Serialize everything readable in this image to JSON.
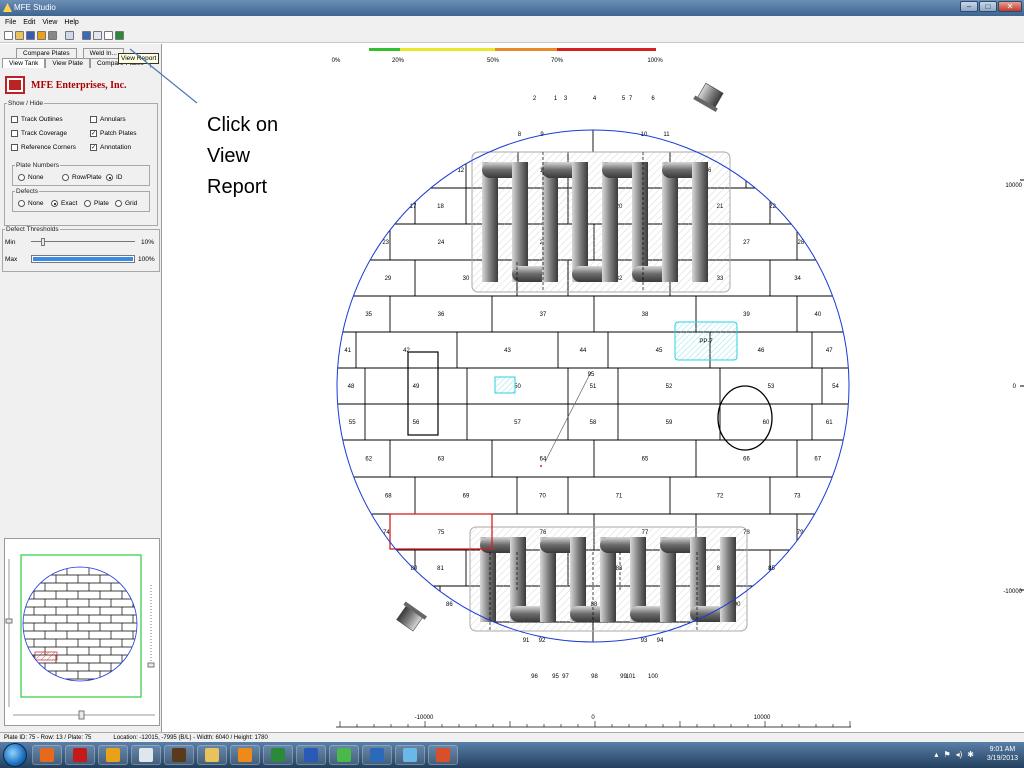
{
  "window": {
    "title": "MFE Studio",
    "controls": [
      "–",
      "□",
      "✕"
    ]
  },
  "menu": [
    "File",
    "Edit",
    "View",
    "Help"
  ],
  "toolbar_icons": [
    "new-icon",
    "open-icon",
    "save-icon",
    "export-icon",
    "print-icon",
    "copy-icon",
    "view-tank-icon",
    "view-plate-icon",
    "report-icon",
    "excel-icon"
  ],
  "tabs": {
    "row1": [
      "Compare Plates",
      "Weld In..."
    ],
    "row2": [
      "View Tank",
      "View Plate",
      "Compare Plates"
    ],
    "tooltip": "View Report"
  },
  "brand": {
    "name": "MFE Enterprises, Inc."
  },
  "show_hide": {
    "legend": "Show / Hide",
    "items": [
      {
        "label": "Track Outlines",
        "checked": false
      },
      {
        "label": "Annulars",
        "checked": false
      },
      {
        "label": "Track Coverage",
        "checked": false
      },
      {
        "label": "Patch Plates",
        "checked": true
      },
      {
        "label": "Reference Corners",
        "checked": false
      },
      {
        "label": "Annotation",
        "checked": true
      }
    ]
  },
  "plate_numbers": {
    "legend": "Plate Numbers",
    "options": [
      "None",
      "Row/Plate",
      "ID"
    ],
    "selected": "ID"
  },
  "defects": {
    "legend": "Defects",
    "options": [
      "None",
      "Exact",
      "Plate",
      "Grid"
    ],
    "selected": "Exact"
  },
  "thresholds": {
    "legend": "Defect Thresholds",
    "min_label": "Min",
    "min_value": "10%",
    "max_label": "Max",
    "max_value": "100%"
  },
  "axis_marker": {
    "y": "Y",
    "x": "X"
  },
  "callout": "Click on View Report",
  "scale_bar": {
    "labels": [
      "0%",
      "20%",
      "50%",
      "70%",
      "100%"
    ],
    "colors": [
      "#2fbf2f",
      "#e8e82a",
      "#e88a2a",
      "#d62020"
    ]
  },
  "right_axis_labels": [
    "10000",
    "0",
    "-10000"
  ],
  "bottom_axis_labels": [
    "-10000",
    "0",
    "10000"
  ],
  "plate_rows": [
    [
      "1",
      "2",
      "3",
      "4",
      "5",
      "6",
      "7"
    ],
    [
      "8",
      "9",
      "10",
      "11"
    ],
    [
      "12",
      "13",
      "14",
      "15",
      "16"
    ],
    [
      "17",
      "18",
      "19",
      "20",
      "21",
      "22"
    ],
    [
      "23",
      "24",
      "25",
      "26",
      "27",
      "28"
    ],
    [
      "29",
      "30",
      "31",
      "32",
      "33",
      "34"
    ],
    [
      "35",
      "36",
      "37",
      "38",
      "39",
      "40"
    ],
    [
      "41",
      "42",
      "43",
      "44",
      "45",
      "46",
      "47"
    ],
    [
      "48",
      "49",
      "50",
      "51",
      "52",
      "53",
      "54"
    ],
    [
      "55",
      "56",
      "57",
      "58",
      "59",
      "60",
      "61"
    ],
    [
      "62",
      "63",
      "64",
      "65",
      "66",
      "67"
    ],
    [
      "68",
      "69",
      "70",
      "71",
      "72",
      "73"
    ],
    [
      "74",
      "75",
      "76",
      "77",
      "78",
      "79"
    ],
    [
      "80",
      "81",
      "82",
      "83",
      "84",
      "85"
    ],
    [
      "86",
      "87",
      "88",
      "89",
      "90"
    ],
    [
      "91",
      "92",
      "93",
      "94"
    ],
    [
      "95",
      "96",
      "97",
      "98",
      "99",
      "100",
      "101"
    ]
  ],
  "annotations": {
    "patch_plate": "PP-7",
    "note": "95"
  },
  "status": {
    "plate": "Plate ID: 75 - Row: 13 / Plate: 75",
    "location": "Location: -12015, -7995 (B/L) - Width: 6040 / Height: 1780"
  },
  "taskbar_apps": [
    {
      "icon": "firefox-icon",
      "color": "#e66a1e"
    },
    {
      "icon": "acrobat-icon",
      "color": "#c41a1a"
    },
    {
      "icon": "outlook-icon",
      "color": "#e8a21a"
    },
    {
      "icon": "document-icon",
      "color": "#dfe6ee"
    },
    {
      "icon": "ups-icon",
      "color": "#5a3a1a"
    },
    {
      "icon": "folder-icon",
      "color": "#e8c25a"
    },
    {
      "icon": "media-player-icon",
      "color": "#ef8a1a"
    },
    {
      "icon": "excel-icon",
      "color": "#2a8a3a"
    },
    {
      "icon": "word-icon",
      "color": "#2a5ab8"
    },
    {
      "icon": "game-icon",
      "color": "#4ab84a"
    },
    {
      "icon": "camera-icon",
      "color": "#2a6ab8"
    },
    {
      "icon": "mfe-studio-icon",
      "color": "#6ab8e8"
    },
    {
      "icon": "powerpoint-icon",
      "color": "#d8502a"
    }
  ],
  "clock": {
    "time": "9:01 AM",
    "date": "3/19/2013"
  }
}
